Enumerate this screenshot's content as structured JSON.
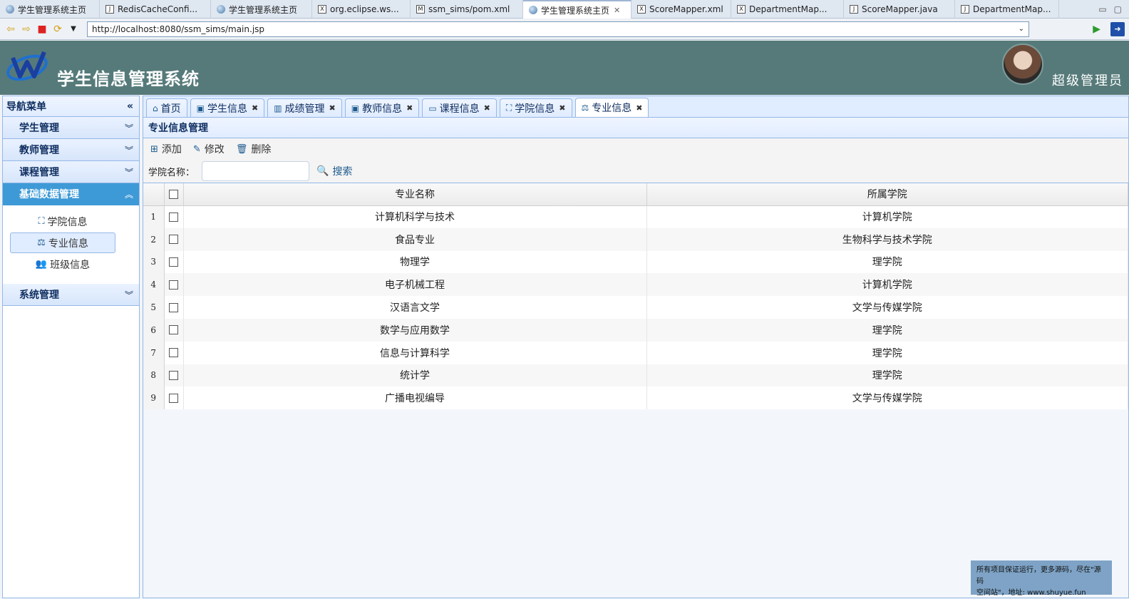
{
  "editor_tabs": [
    {
      "label": "学生管理系统主页",
      "icon": "globe-icon",
      "active": false
    },
    {
      "label": "RedisCacheConfi...",
      "icon": "java-file-icon",
      "active": false
    },
    {
      "label": "学生管理系统主页",
      "icon": "globe-icon",
      "active": false
    },
    {
      "label": "org.eclipse.ws...",
      "icon": "xml-file-icon",
      "active": false
    },
    {
      "label": "ssm_sims/pom.xml",
      "icon": "maven-file-icon",
      "active": false
    },
    {
      "label": "学生管理系统主页",
      "icon": "globe-icon",
      "active": true
    },
    {
      "label": "ScoreMapper.xml",
      "icon": "xml-file-icon",
      "active": false
    },
    {
      "label": "DepartmentMap...",
      "icon": "xml-file-icon",
      "active": false
    },
    {
      "label": "ScoreMapper.java",
      "icon": "java-file-icon",
      "active": false
    },
    {
      "label": "DepartmentMap...",
      "icon": "java-file-icon",
      "active": false
    }
  ],
  "browser": {
    "url": "http://localhost:8080/ssm_sims/main.jsp"
  },
  "header": {
    "title": "学生信息管理系统",
    "role": "超级管理员"
  },
  "sidebar": {
    "title": "导航菜单",
    "groups": [
      {
        "label": "学生管理"
      },
      {
        "label": "教师管理"
      },
      {
        "label": "课程管理"
      },
      {
        "label": "基础数据管理"
      },
      {
        "label": "系统管理"
      }
    ],
    "sub_items": [
      {
        "label": "学院信息",
        "icon": "sitemap-icon"
      },
      {
        "label": "专业信息",
        "icon": "balance-scale-icon"
      },
      {
        "label": "班级信息",
        "icon": "users-icon"
      }
    ]
  },
  "tabs": [
    {
      "label": "首页",
      "icon": "home-icon",
      "closable": false
    },
    {
      "label": "学生信息",
      "icon": "id-card-icon",
      "closable": true
    },
    {
      "label": "成绩管理",
      "icon": "bar-chart-icon",
      "closable": true
    },
    {
      "label": "教师信息",
      "icon": "id-card-icon",
      "closable": true
    },
    {
      "label": "课程信息",
      "icon": "calendar-icon",
      "closable": true
    },
    {
      "label": "学院信息",
      "icon": "sitemap-icon",
      "closable": true
    },
    {
      "label": "专业信息",
      "icon": "balance-scale-icon",
      "closable": true
    }
  ],
  "panel": {
    "title": "专业信息管理"
  },
  "toolbar": {
    "add": "添加",
    "edit": "修改",
    "delete": "删除"
  },
  "search": {
    "label": "学院名称：",
    "value": "",
    "button": "搜索"
  },
  "table": {
    "columns": [
      "专业名称",
      "所属学院"
    ],
    "rows": [
      {
        "n": "1",
        "major": "计算机科学与技术",
        "college": "计算机学院"
      },
      {
        "n": "2",
        "major": "食品专业",
        "college": "生物科学与技术学院"
      },
      {
        "n": "3",
        "major": "物理学",
        "college": "理学院"
      },
      {
        "n": "4",
        "major": "电子机械工程",
        "college": "计算机学院"
      },
      {
        "n": "5",
        "major": "汉语言文学",
        "college": "文学与传媒学院"
      },
      {
        "n": "6",
        "major": "数学与应用数学",
        "college": "理学院"
      },
      {
        "n": "7",
        "major": "信息与计算科学",
        "college": "理学院"
      },
      {
        "n": "8",
        "major": "统计学",
        "college": "理学院"
      },
      {
        "n": "9",
        "major": "广播电视编导",
        "college": "文学与传媒学院"
      }
    ]
  },
  "watermark": {
    "line1": "所有项目保证运行，更多源码，尽在\"源码",
    "line2": "空间站\"，地址: www.shuyue.fun"
  }
}
